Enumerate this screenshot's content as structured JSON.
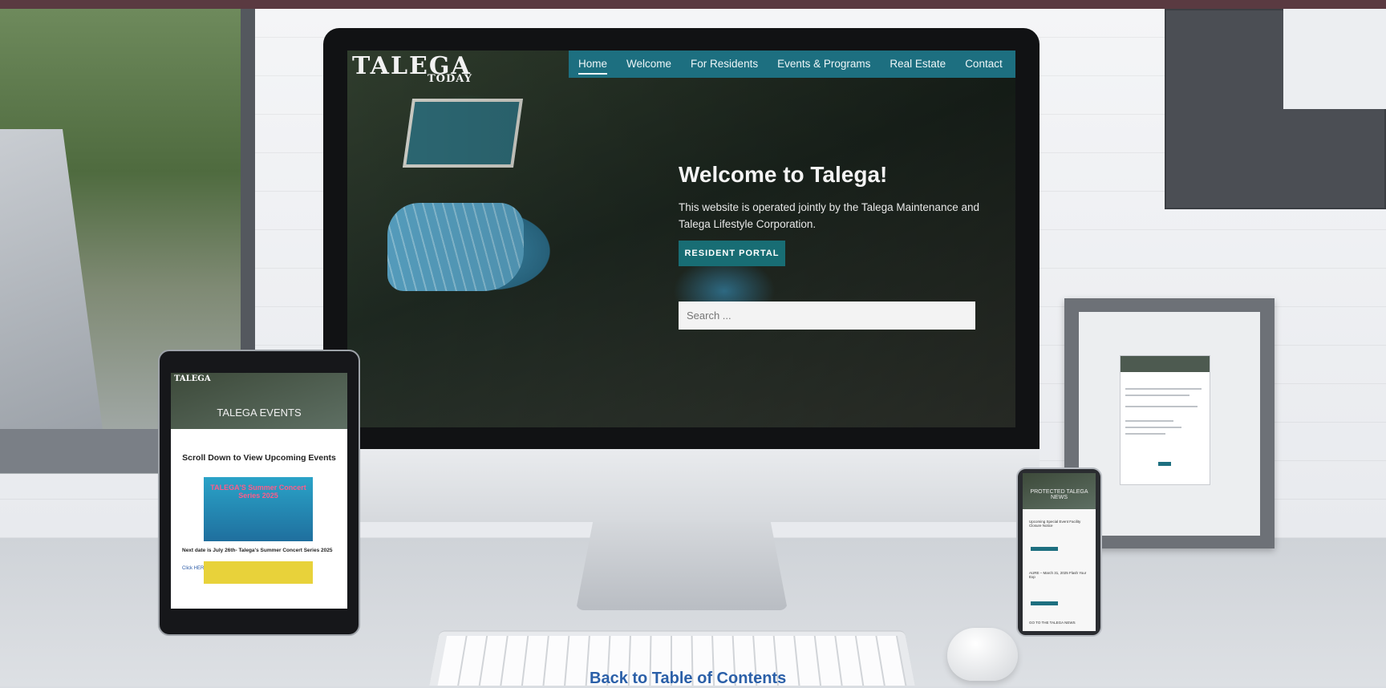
{
  "imac": {
    "logo_main": "TALEGA",
    "logo_sub": "TODAY",
    "nav": [
      "Home",
      "Welcome",
      "For Residents",
      "Events & Programs",
      "Real Estate",
      "Contact"
    ],
    "hero_title": "Welcome to Talega!",
    "hero_text": "This website is operated jointly by the Talega Maintenance and Talega Lifestyle Corporation.",
    "portal_button": "RESIDENT PORTAL",
    "search_placeholder": "Search ..."
  },
  "tablet": {
    "logo": "TALEGA",
    "hero_title": "TALEGA EVENTS",
    "heading": "Scroll Down to View Upcoming Events",
    "poster_text": "TALEGA'S Summer Concert Series 2025",
    "caption": "Next date is July 26th- Talega's Summer Concert Series 2025",
    "link": "Click HERE for more information"
  },
  "phone": {
    "hero_title": "PROTECTED TALEGA NEWS",
    "card1": "Upcoming Special Event Facility Closure Notice",
    "card2": "AURE – March 31, 2025 Flash Your Exp",
    "footer": "GO TO THE TALEGA NEWS"
  },
  "footer": {
    "back_link": "Back to Table of Contents"
  },
  "colors": {
    "nav_teal": "#1d6f80",
    "button_teal": "#186d74",
    "top_strip": "#5a3a41",
    "link_blue": "#2a5fa8"
  }
}
